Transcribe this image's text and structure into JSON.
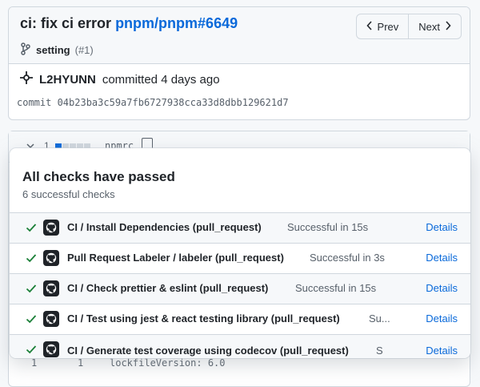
{
  "commit": {
    "title": "ci: fix ci error",
    "repo_ref": "pnpm/pnpm#6649",
    "branch_name": "setting",
    "branch_number": "(#1)",
    "author": "L2HYUNN",
    "committed_text": "committed 4 days ago",
    "sha_line": "commit 04b23ba3c59a7fb6727938cca33d8dbb129621d7"
  },
  "pager": {
    "prev_label": "Prev",
    "next_label": "Next"
  },
  "diff": {
    "count": "1",
    "filename": "npmrc",
    "footer_left": "1",
    "footer_right": "1",
    "footer_code": "lockfileVersion: 6.0"
  },
  "checks": {
    "title": "All checks have passed",
    "subtitle": "6 successful checks",
    "items": [
      {
        "name": "CI / Install Dependencies (pull_request)",
        "status": "Successful in 15s",
        "details": "Details"
      },
      {
        "name": "Pull Request Labeler / labeler (pull_request)",
        "status": "Successful in 3s",
        "details": "Details"
      },
      {
        "name": "CI / Check prettier & eslint (pull_request)",
        "status": "Successful in 15s",
        "details": "Details"
      },
      {
        "name": "CI / Test using jest & react testing library (pull_request)",
        "status": "Su...",
        "details": "Details"
      },
      {
        "name": "CI / Generate test coverage using codecov (pull_request)",
        "status": "S",
        "details": "Details"
      }
    ]
  },
  "colors": {
    "success": "#1a7f37",
    "link": "#0969da",
    "border": "#d0d7de"
  }
}
